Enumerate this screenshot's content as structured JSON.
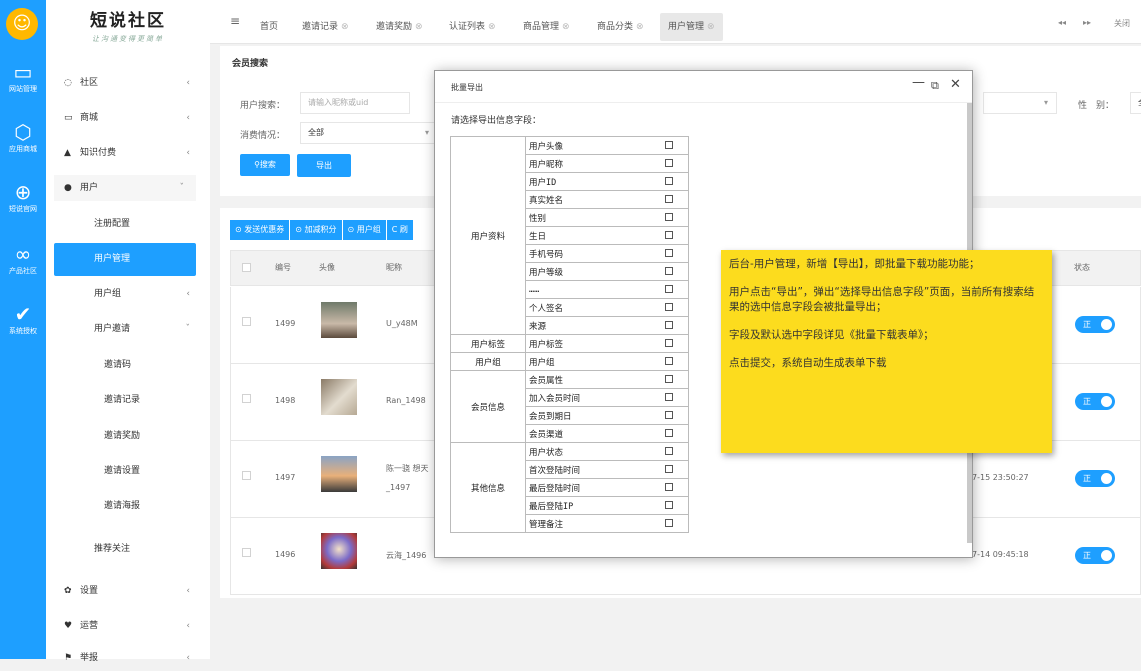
{
  "leftbar": {
    "items": [
      {
        "label": "网站管理",
        "icon": "monitor-icon"
      },
      {
        "label": "应用商城",
        "icon": "cube-icon"
      },
      {
        "label": "短说官网",
        "icon": "globe-icon"
      },
      {
        "label": "产品社区",
        "icon": "link-icon"
      },
      {
        "label": "系统授权",
        "icon": "shield-check-icon"
      }
    ]
  },
  "brand": {
    "title": "短说社区",
    "slogan": "让沟通变得更简单"
  },
  "menu": {
    "community": "社区",
    "mall": "商城",
    "knowledge": "知识付费",
    "user": "用户",
    "register_config": "注册配置",
    "user_manage": "用户管理",
    "user_group": "用户组",
    "user_invite": "用户邀请",
    "invite_code": "邀请码",
    "invite_record": "邀请记录",
    "invite_reward": "邀请奖励",
    "invite_settings": "邀请设置",
    "invite_poster": "邀请海报",
    "recommend": "推荐关注",
    "settings": "设置",
    "operation": "运营",
    "more": "举报"
  },
  "topbar": {
    "menu_icon": "≡",
    "tabs": [
      "首页",
      "邀请记录",
      "邀请奖励",
      "认证列表",
      "商品管理",
      "商品分类",
      "用户管理"
    ],
    "close": "关闭"
  },
  "search": {
    "title": "会员搜索",
    "user_label": "用户搜索：",
    "user_placeholder": "请输入昵称或uid",
    "consume_label": "消费情况：",
    "consume_value": "全部",
    "gender_label": "性　别：",
    "gender_value": "全部",
    "search_btn": "搜索",
    "export_btn": "导出"
  },
  "table": {
    "toolbar": [
      "发送优惠券",
      "加减积分",
      "用户组",
      "刷"
    ],
    "headers": {
      "id": "编号",
      "avatar": "头像",
      "nickname": "昵称",
      "status": "状态"
    },
    "rows": [
      {
        "id": "1499",
        "nickname": "U_y48M",
        "nickname2": "",
        "time": "",
        "status": "正"
      },
      {
        "id": "1498",
        "nickname": "Ran_1498",
        "nickname2": "",
        "time": "",
        "status": "正"
      },
      {
        "id": "1497",
        "nickname": "陈一骁 想天",
        "nickname2": "_1497",
        "time": "7-15 23:50:27",
        "status": "正"
      },
      {
        "id": "1496",
        "nickname": "云海_1496",
        "nickname2": "",
        "time": "7-14 09:45:18",
        "status": "正"
      }
    ]
  },
  "modal": {
    "title": "批量导出",
    "subtitle": "请选择导出信息字段：",
    "groups": [
      {
        "name": "用户资料",
        "fields": [
          "用户头像",
          "用户昵称",
          "用户ID",
          "真实姓名",
          "性别",
          "生日",
          "手机号码",
          "用户等级",
          "……",
          "个人签名",
          "来源"
        ]
      },
      {
        "name": "用户标签",
        "fields": [
          "用户标签"
        ]
      },
      {
        "name": "用户组",
        "fields": [
          "用户组"
        ]
      },
      {
        "name": "会员信息",
        "fields": [
          "会员属性",
          "加入会员时间",
          "会员到期日",
          "会员渠道"
        ]
      },
      {
        "name": "其他信息",
        "fields": [
          "用户状态",
          "首次登陆时间",
          "最后登陆时间",
          "最后登陆IP",
          "管理备注"
        ]
      }
    ]
  },
  "note": {
    "p1": "后台-用户管理，新增【导出】，即批量下载功能功能；",
    "p2": "用户点击“导出”，弹出“选择导出信息字段”页面，当前所有搜索结果的选中信息字段会被批量导出；",
    "p3": "字段及默认选中字段详见《批量下载表单》；",
    "p4": "点击提交，系统自动生成表单下载"
  }
}
